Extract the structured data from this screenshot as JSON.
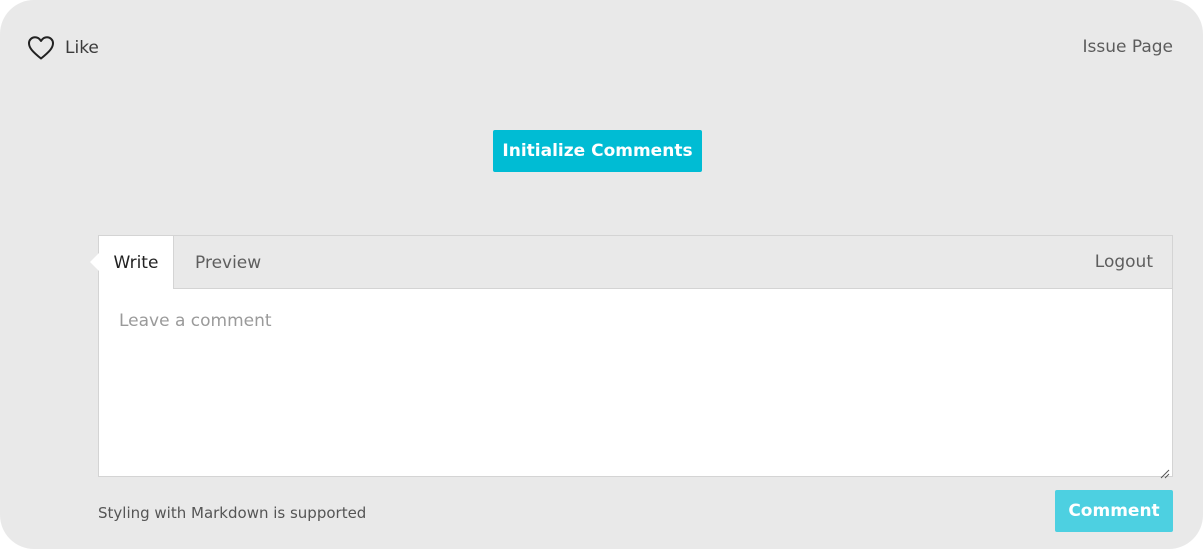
{
  "header": {
    "like_label": "Like",
    "like_icon": "heart-icon",
    "issue_page_label": "Issue Page"
  },
  "init": {
    "button_label": "Initialize Comments"
  },
  "editor": {
    "tabs": [
      {
        "label": "Write",
        "active": true
      },
      {
        "label": "Preview",
        "active": false
      }
    ],
    "logout_label": "Logout",
    "textarea": {
      "value": "",
      "placeholder": "Leave a comment"
    }
  },
  "footer": {
    "markdown_note": "Styling with Markdown is supported",
    "comment_label": "Comment"
  },
  "colors": {
    "panel_background": "#e9e9e9",
    "accent": "#00bcd4",
    "accent_light": "#4dd0e1"
  }
}
